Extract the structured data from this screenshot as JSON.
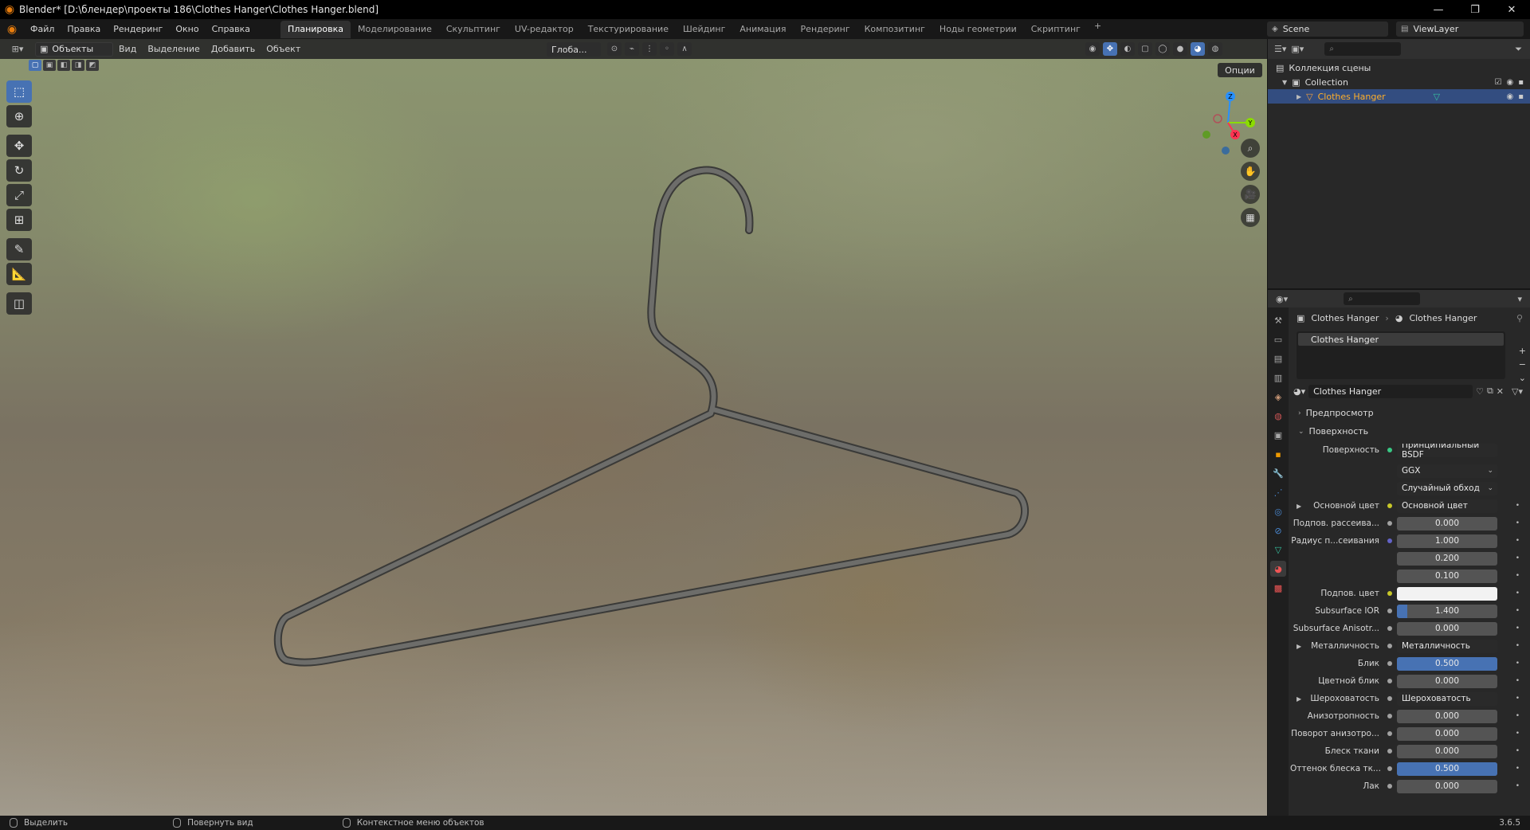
{
  "window": {
    "title": "Blender* [D:\\блендер\\проекты 186\\Clothes Hanger\\Clothes Hanger.blend]",
    "controls": [
      "—",
      "❐",
      "✕"
    ]
  },
  "menu": [
    "Файл",
    "Правка",
    "Рендеринг",
    "Окно",
    "Справка"
  ],
  "workspaces": [
    "Планировка",
    "Моделирование",
    "Скульптинг",
    "UV-редактор",
    "Текстурирование",
    "Шейдинг",
    "Анимация",
    "Рендеринг",
    "Композитинг",
    "Ноды геометрии",
    "Скриптинг"
  ],
  "active_workspace": "Планировка",
  "workspace_add": "+",
  "scene": "Scene",
  "view_layer": "ViewLayer",
  "viewport": {
    "mode": "Объекты",
    "menus": [
      "Вид",
      "Выделение",
      "Добавить",
      "Объект"
    ],
    "transform_orientation": "Глоба...",
    "options": "Опции",
    "gizmo": {
      "x": "X",
      "y": "Y",
      "z": "Z"
    }
  },
  "outliner": {
    "rows": [
      {
        "label": "Коллекция сцены",
        "indent": 0
      },
      {
        "label": "Collection",
        "indent": 1
      },
      {
        "label": "Clothes Hanger",
        "indent": 2,
        "selected": true
      }
    ]
  },
  "properties": {
    "breadcrumb": {
      "object": "Clothes Hanger",
      "material": "Clothes Hanger"
    },
    "slot": "Clothes Hanger",
    "material_name": "Clothes Hanger",
    "panels": {
      "preview": "Предпросмотр",
      "surface": "Поверхность"
    },
    "surface": {
      "label": "Поверхность",
      "shader": "Принципиальный BSDF",
      "distribution": "GGX",
      "subsurface_method": "Случайный обход"
    },
    "rows": [
      {
        "label": "Основной цвет",
        "value": "Основной цвет",
        "kind": "link",
        "dot": "#c7c729",
        "arrow": true
      },
      {
        "label": "Подпов. рассеива...",
        "value": "0.000",
        "kind": "num",
        "dot": "#a1a1a1"
      },
      {
        "label": "Радиус п...сеивания",
        "value": "1.000",
        "kind": "num",
        "dot": "#6363c7"
      },
      {
        "label": "",
        "value": "0.200",
        "kind": "num",
        "dot": ""
      },
      {
        "label": "",
        "value": "0.100",
        "kind": "num",
        "dot": ""
      },
      {
        "label": "Подпов. цвет",
        "value": "",
        "kind": "color",
        "dot": "#c7c729"
      },
      {
        "label": "Subsurface IOR",
        "value": "1.400",
        "kind": "num",
        "dot": "#a1a1a1",
        "fill": 0.1
      },
      {
        "label": "Subsurface Anisotr...",
        "value": "0.000",
        "kind": "num",
        "dot": "#a1a1a1"
      },
      {
        "label": "Металличность",
        "value": "Металличность",
        "kind": "link",
        "dot": "#a1a1a1",
        "arrow": true
      },
      {
        "label": "Блик",
        "value": "0.500",
        "kind": "num",
        "dot": "#a1a1a1",
        "fill": 1.0
      },
      {
        "label": "Цветной блик",
        "value": "0.000",
        "kind": "num",
        "dot": "#a1a1a1"
      },
      {
        "label": "Шероховатость",
        "value": "Шероховатость",
        "kind": "link",
        "dot": "#a1a1a1",
        "arrow": true
      },
      {
        "label": "Анизотропность",
        "value": "0.000",
        "kind": "num",
        "dot": "#a1a1a1"
      },
      {
        "label": "Поворот анизотро...",
        "value": "0.000",
        "kind": "num",
        "dot": "#a1a1a1"
      },
      {
        "label": "Блеск ткани",
        "value": "0.000",
        "kind": "num",
        "dot": "#a1a1a1"
      },
      {
        "label": "Оттенок блеска тк...",
        "value": "0.500",
        "kind": "num",
        "dot": "#a1a1a1",
        "fill": 1.0
      },
      {
        "label": "Лак",
        "value": "0.000",
        "kind": "num",
        "dot": "#a1a1a1"
      }
    ]
  },
  "statusbar": {
    "select": "Выделить",
    "rotate": "Повернуть вид",
    "context": "Контекстное меню объектов",
    "version": "3.6.5"
  },
  "colors": {
    "accent": "#4772b3",
    "selected_text": "#ffaf29",
    "x_axis": "#ff3352",
    "y_axis": "#8bdc00",
    "z_axis": "#2890ff"
  }
}
